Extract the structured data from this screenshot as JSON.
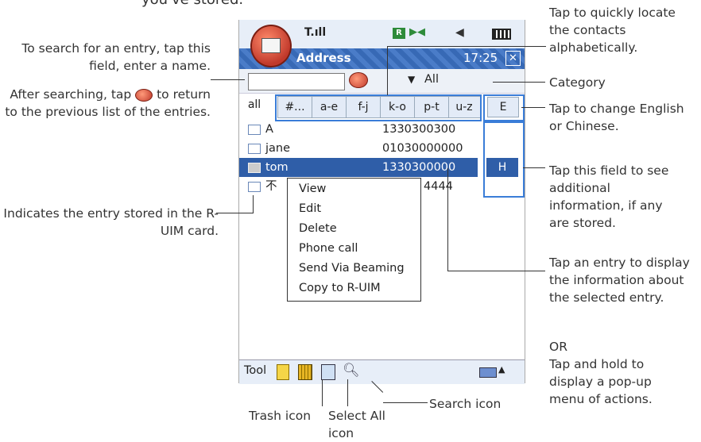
{
  "header_text": "you've stored.",
  "phone": {
    "title": "Address",
    "time": "17:25",
    "signal": "T.ıll",
    "category_value": "All",
    "tabs": [
      "all",
      "#...",
      "a-e",
      "f-j",
      "k-o",
      "p-t",
      "u-z"
    ],
    "language_button": "E",
    "contacts": [
      {
        "name": "A",
        "number": "1330300300",
        "selected": false
      },
      {
        "name": "jane",
        "number": "01030000000",
        "selected": false
      },
      {
        "name": "tom",
        "number": "1330300000",
        "selected": true
      },
      {
        "name": "不",
        "number": "4444",
        "selected": false
      }
    ],
    "info_button": "H",
    "context_menu": [
      "View",
      "Edit",
      "Delete",
      "Phone call",
      "Send Via Beaming",
      "Copy to R-UIM"
    ],
    "toolbar_label": "Tool"
  },
  "annotations": {
    "search_field": "To search for an entry, tap this field, enter a name.",
    "return_prefix": "After searching, tap",
    "return_suffix": "to return to the previous list of the entries.",
    "ruim": "Indicates the entry stored in the R-UIM card.",
    "alpha": "Tap to quickly locate the contacts alphabetically.",
    "category": "Category",
    "language": "Tap to change English or Chinese.",
    "additional": "Tap this field to see additional information, if any are stored.",
    "entry": "Tap an entry to display the information about the selected entry.",
    "or": "OR",
    "hold": "Tap and hold to display a pop-up menu of actions.",
    "trash": "Trash icon",
    "select_all": "Select All icon",
    "search": "Search icon"
  },
  "colors": {
    "title_bar": "#3769b5",
    "selection": "#2f5ea8",
    "highlight_box": "#3a7dd8"
  }
}
